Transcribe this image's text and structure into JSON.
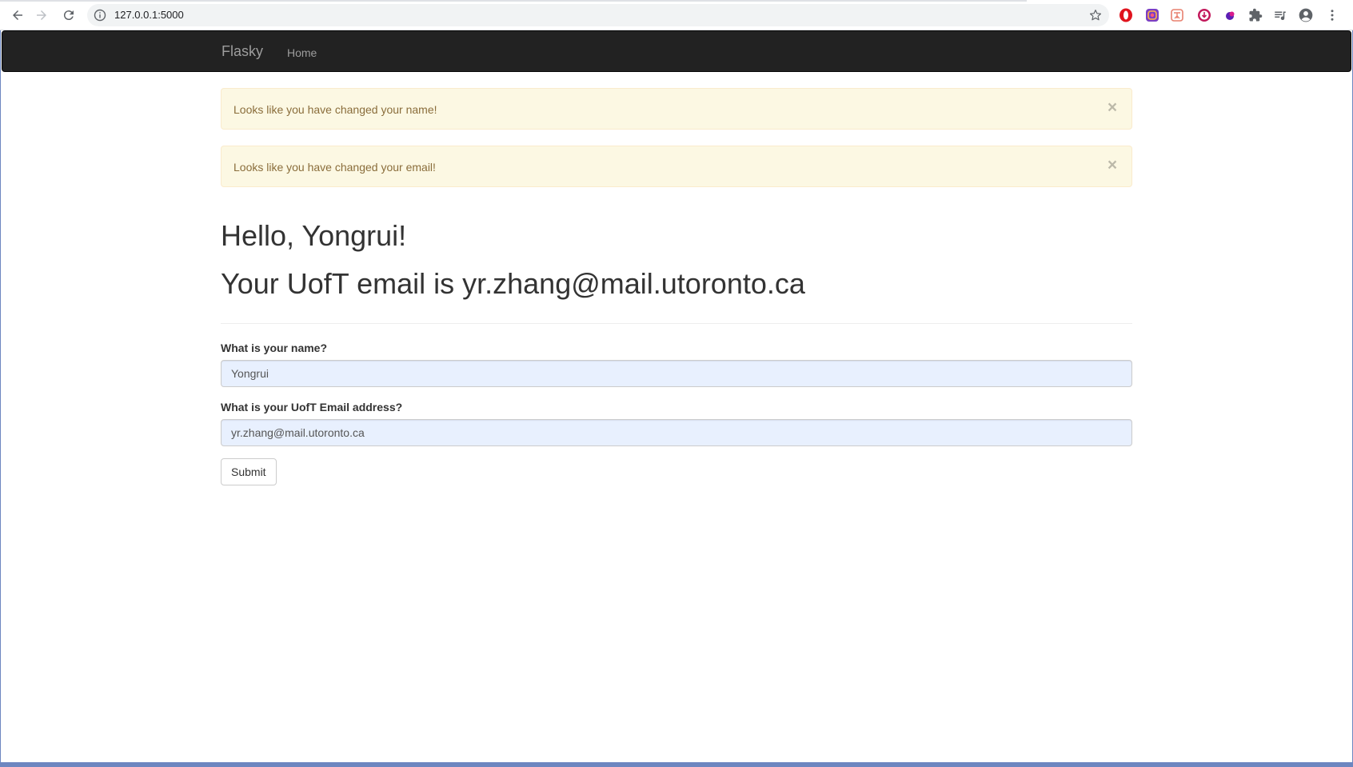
{
  "browser": {
    "url": "127.0.0.1:5000",
    "icons": {
      "back": "back-arrow-icon",
      "forward": "forward-arrow-icon",
      "reload": "reload-icon",
      "site_info": "info-icon",
      "bookmark": "star-icon"
    },
    "extensions": [
      "opera-extension-icon",
      "instagram-extension-icon",
      "translate-extension-icon",
      "download-extension-icon",
      "purple-dot-extension-icon",
      "puzzle-extensions-icon",
      "media-queue-icon",
      "profile-avatar-icon",
      "more-menu-icon"
    ]
  },
  "navbar": {
    "brand": "Flasky",
    "links": [
      {
        "label": "Home"
      }
    ],
    "background": "#222222"
  },
  "alerts": [
    {
      "message": "Looks like you have changed your name!",
      "close": "×"
    },
    {
      "message": "Looks like you have changed your email!",
      "close": "×"
    }
  ],
  "header": {
    "greeting": "Hello, Yongrui!",
    "email_line": "Your UofT email is yr.zhang@mail.utoronto.ca"
  },
  "form": {
    "name_label": "What is your name?",
    "name_value": "Yongrui",
    "email_label": "What is your UofT Email address?",
    "email_value": "yr.zhang@mail.utoronto.ca",
    "submit_label": "Submit"
  },
  "colors": {
    "alert_bg": "#fcf8e3",
    "alert_text": "#8a6d3b",
    "autofill_bg": "#e8f0fe",
    "frame_border": "#6d86c0"
  }
}
